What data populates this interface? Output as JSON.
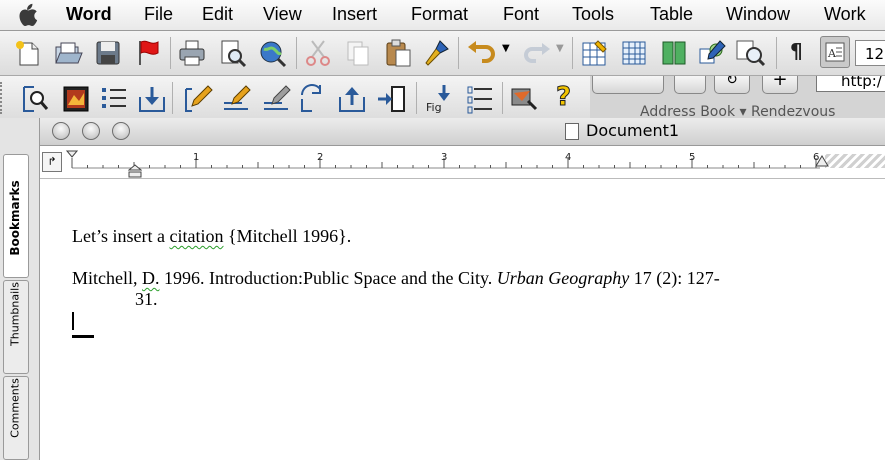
{
  "menubar": {
    "app": "Word",
    "items": [
      "File",
      "Edit",
      "View",
      "Insert",
      "Format",
      "Font",
      "Tools",
      "Table",
      "Window",
      "Work"
    ]
  },
  "toolbar": {
    "font_size": "12",
    "pilcrow": "¶",
    "icons": [
      "new-document-icon",
      "open-icon",
      "save-icon",
      "flag-icon",
      "print-icon",
      "print-preview-icon",
      "web-preview-icon",
      "cut-icon",
      "copy-icon",
      "paste-icon",
      "format-painter-icon",
      "undo-icon",
      "redo-icon",
      "tables-borders-icon",
      "insert-table-icon",
      "columns-icon",
      "drawing-icon",
      "zoom-icon",
      "show-formatting-icon",
      "formatting-palette-icon"
    ]
  },
  "toolbar2": {
    "icons": [
      "find-citation-icon",
      "insert-picture-icon",
      "format-bibliography-icon",
      "export-icon",
      "edit-citation-icon",
      "edit-library-icon",
      "manuscript-icon",
      "unformat-icon",
      "go-to-endnote-icon",
      "instant-format-icon",
      "insert-figure-icon",
      "bibliography-settings-icon",
      "preferences-icon",
      "help-icon"
    ],
    "help_label": "?",
    "fig_label": "Fig"
  },
  "browser": {
    "url": "http:/",
    "bookmarks_text": "Address Book ▾  Rendezvous"
  },
  "document": {
    "title": "Document1",
    "ruler_numbers": [
      "1",
      "2",
      "3",
      "4",
      "5",
      "6"
    ],
    "line1_part1": "Let’s insert a ",
    "line1_squiggle": "citation",
    "line1_part2": " {Mitchell 1996}.",
    "ref_part1": "Mitchell, ",
    "ref_squiggle": "D.",
    "ref_part2": " 1996. Introduction:Public Space and the City. ",
    "ref_journal": "Urban Geography",
    "ref_part3": " 17 (2): 127-",
    "ref_line2": "31."
  },
  "drawer": {
    "tabs": [
      "Bookmarks",
      "Thumbnails",
      "Comments"
    ]
  }
}
